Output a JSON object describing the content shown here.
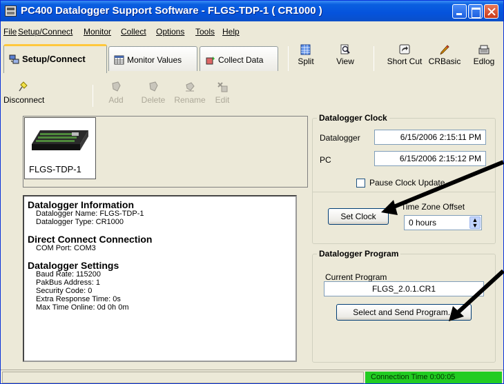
{
  "window": {
    "title": "PC400 Datalogger Support Software - FLGS-TDP-1 ( CR1000 )"
  },
  "menu": [
    {
      "label": "File"
    },
    {
      "label": "Setup/Connect"
    },
    {
      "label": "Monitor"
    },
    {
      "label": "Collect"
    },
    {
      "label": "Options"
    },
    {
      "label": "Tools"
    },
    {
      "label": "Help"
    }
  ],
  "tabs": [
    {
      "label": "Setup/Connect",
      "active": true,
      "icon": "computer-connect-icon"
    },
    {
      "label": "Monitor Values",
      "active": false,
      "icon": "table-grid-icon"
    },
    {
      "label": "Collect Data",
      "active": false,
      "icon": "collect-data-icon"
    }
  ],
  "toolbar": [
    {
      "label": "Split",
      "icon": "split-icon"
    },
    {
      "label": "View",
      "icon": "view-magnifier-icon"
    },
    {
      "label": "Short Cut",
      "icon": "shortcut-icon"
    },
    {
      "label": "CRBasic",
      "icon": "crbasic-pencil-icon"
    },
    {
      "label": "Edlog",
      "icon": "edlog-icon"
    }
  ],
  "setup_toolbar": [
    {
      "label": "Disconnect",
      "enabled": true,
      "icon": "disconnect-plug-icon"
    },
    {
      "label": "Add",
      "enabled": false,
      "icon": "add-station-icon"
    },
    {
      "label": "Delete",
      "enabled": false,
      "icon": "delete-station-icon"
    },
    {
      "label": "Rename",
      "enabled": false,
      "icon": "rename-station-icon"
    },
    {
      "label": "Edit",
      "enabled": false,
      "icon": "edit-station-icon"
    }
  ],
  "device": {
    "name": "FLGS-TDP-1"
  },
  "info": {
    "datalogger_heading": "Datalogger Information",
    "datalogger_name": "Datalogger Name: FLGS-TDP-1",
    "datalogger_type": "Datalogger Type: CR1000",
    "connection_heading": "Direct Connect Connection",
    "com_port": "COM Port: COM3",
    "settings_heading": "Datalogger Settings",
    "baud_rate": "Baud Rate: 115200",
    "pakbus": "PakBus Address: 1",
    "security": "Security Code: 0",
    "extra_response": "Extra Response Time: 0s",
    "max_time": "Max Time Online: 0d 0h 0m"
  },
  "clock": {
    "title": "Datalogger Clock",
    "datalogger_label": "Datalogger",
    "datalogger_value": "6/15/2006 2:15:11 PM",
    "pc_label": "PC",
    "pc_value": "6/15/2006 2:15:12 PM",
    "pause_label": "Pause Clock Update",
    "pause_checked": false,
    "set_clock_label": "Set Clock",
    "timezone_label": "Time Zone Offset",
    "timezone_value": "0 hours"
  },
  "program": {
    "title": "Datalogger Program",
    "current_label": "Current Program",
    "current_value": "FLGS_2.0.1.CR1",
    "send_label": "Select and Send Program..."
  },
  "status": {
    "connection_time": "Connection Time 0:00:05"
  },
  "colors": {
    "titlebar": "#0553DC",
    "window_bg": "#ECE9D8",
    "status_green": "#22CC22",
    "active_tab_accent": "#FFC83C"
  }
}
